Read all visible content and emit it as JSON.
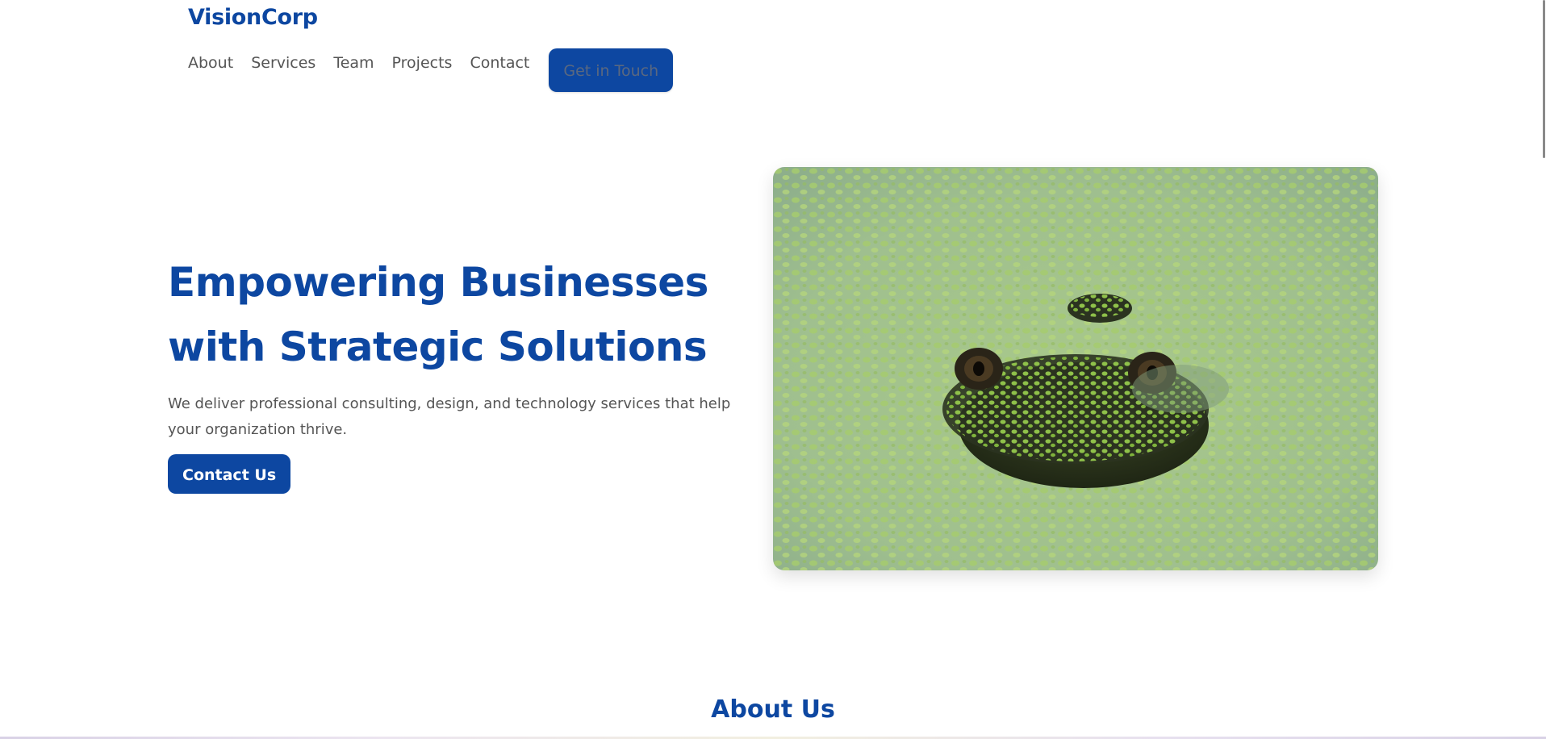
{
  "header": {
    "brand": "VisionCorp",
    "nav": {
      "about": "About",
      "services": "Services",
      "team": "Team",
      "projects": "Projects",
      "contact": "Contact"
    },
    "cta_label": "Get in Touch"
  },
  "hero": {
    "title": "Empowering Businesses with Strategic Solutions",
    "subtitle": "We deliver professional consulting, design, and technology services that help your organization thrive.",
    "button_label": "Contact Us",
    "image_icon": "frog-in-duckweed-photo"
  },
  "about": {
    "title": "About Us"
  },
  "colors": {
    "brand": "#0d47a1",
    "text_muted": "#555555",
    "background": "#ffffff"
  }
}
